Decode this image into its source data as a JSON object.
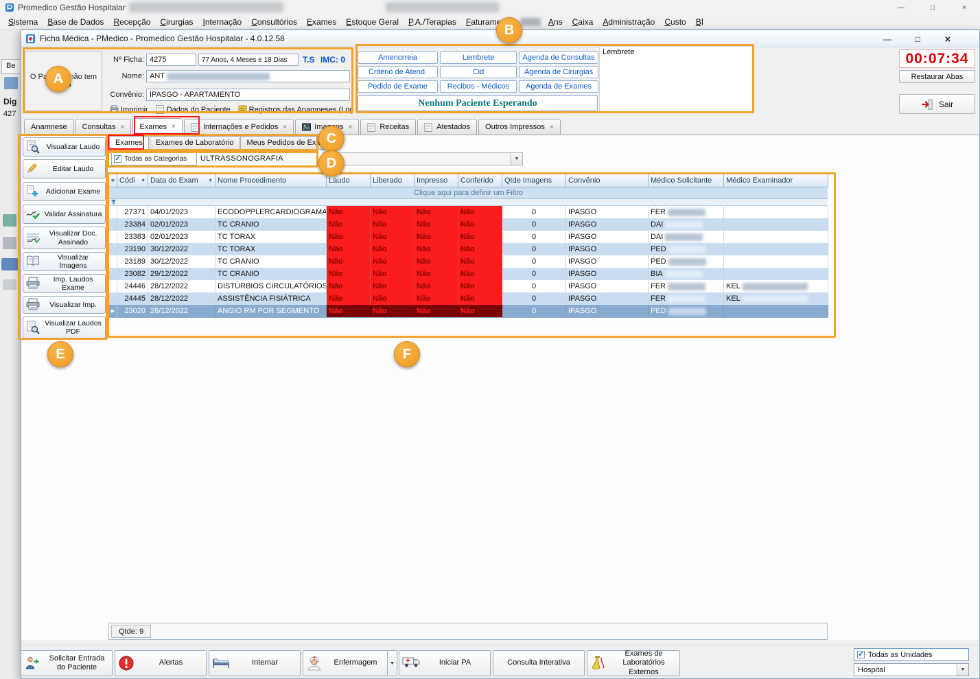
{
  "window": {
    "title": "Promedico Gestão Hospitalar",
    "inner_title": "Ficha Médica - PMedico - Promedico Gestão Hospitalar - 4.0.12.58"
  },
  "menu": {
    "items": [
      "Sistema",
      "Base de Dados",
      "Recepção",
      "Cirurgias",
      "Internação",
      "Consultórios",
      "Exames",
      "Estoque Geral",
      "P.A./Terapias",
      "Faturamento",
      "Ans",
      "Caixa",
      "Administração",
      "Custo",
      "BI"
    ]
  },
  "background_fragments": {
    "partial_tab": "Be",
    "label_dig": "Dig",
    "label_427": "427"
  },
  "patient": {
    "photo_placeholder": "O Paciente não tem Foto",
    "ficha_label": "Nº Ficha:",
    "ficha_value": "4275",
    "age_text": "77 Anos, 4 Meses e 18 Dias",
    "ts_label": "T.S",
    "imc_label": "IMC: 0",
    "nome_label": "Nome:",
    "nome_value_visible": "ANT",
    "convenio_label": "Convênio:",
    "convenio_value": "IPASGO - APARTAMENTO",
    "toolbar_items": [
      "Imprimir",
      "Dados do Paciente",
      "Registros das Anamneses (Log"
    ]
  },
  "quick_actions": {
    "buttons": [
      "Amenorreia",
      "Lembrete",
      "Agenda de Consultas",
      "Critério de Atend.",
      "Cid",
      "Agenda de Cirurgias",
      "Pedido de Exame",
      "Recibos - Médicos",
      "Agenda de Exames"
    ],
    "waiting_banner": "Nenhum Paciente Esperando"
  },
  "lembrete_panel": {
    "title": "Lembrete"
  },
  "session": {
    "timer": "00:07:34",
    "restore_tabs_label": "Restaurar Abas",
    "exit_label": "Sair"
  },
  "tabs": [
    {
      "label": "Anamnese",
      "close": false,
      "icon": false,
      "active": false
    },
    {
      "label": "Consultas",
      "close": true,
      "icon": false,
      "active": false
    },
    {
      "label": "Exames",
      "close": true,
      "icon": false,
      "active": true
    },
    {
      "label": "Internações e Pedidos",
      "close": true,
      "icon": true,
      "active": false
    },
    {
      "label": "Imagens",
      "close": true,
      "icon": true,
      "active": false
    },
    {
      "label": "Receitas",
      "close": false,
      "icon": true,
      "active": false
    },
    {
      "label": "Atestados",
      "close": false,
      "icon": true,
      "active": false
    },
    {
      "label": "Outros Impressos",
      "close": true,
      "icon": false,
      "active": false
    }
  ],
  "subtabs": [
    {
      "label": "Exames",
      "active": true
    },
    {
      "label": "Exames de Laboratório",
      "active": false
    },
    {
      "label": "Meus Pedidos de Exame",
      "active": false
    }
  ],
  "category_filter": {
    "checkbox_label": "Todas as Categorias",
    "checked": true,
    "category_text": "ULTRASSONOGRAFIA"
  },
  "sidebar": {
    "items": [
      {
        "label": "Visualizar Laudo",
        "icon": "view-report-icon"
      },
      {
        "label": "Editar Laudo",
        "icon": "edit-pencil-icon"
      },
      {
        "label": "Adicionar Exame",
        "icon": "add-exam-icon"
      },
      {
        "label": "Validar Assinatura",
        "icon": "validate-signature-icon"
      },
      {
        "label": "Visualizar Doc. Assinado",
        "icon": "signed-doc-icon"
      },
      {
        "label": "Visualizar Imagens",
        "icon": "view-images-icon"
      },
      {
        "label": "Imp. Laudos Exame",
        "icon": "print-report-icon"
      },
      {
        "label": "Visualizar Imp.",
        "icon": "print-preview-icon"
      },
      {
        "label": "Visualizar Laudos PDF",
        "icon": "view-pdf-icon"
      }
    ]
  },
  "grid": {
    "columns": [
      "Códi",
      "Data do Exam",
      "Nome Procedimento",
      "Laudo",
      "Liberado",
      "Impresso",
      "Conferido",
      "Qtde Imagens",
      "Convênio",
      "Médico Solicitante",
      "Médico Examinador"
    ],
    "filter_hint": "Clique aqui para definir um Filtro",
    "rows": [
      {
        "codigo": "27371",
        "data": "04/01/2023",
        "procedimento": "ECODOPPLERCARDIOGRAMA",
        "laudo": "Não",
        "liberado": "Não",
        "impresso": "Não",
        "conferido": "Não",
        "qtde_imagens": "0",
        "convenio": "IPASGO",
        "solicitante": "FER",
        "examinador": "",
        "selected": false
      },
      {
        "codigo": "23384",
        "data": "02/01/2023",
        "procedimento": "TC CRANIO",
        "laudo": "Não",
        "liberado": "Não",
        "impresso": "Não",
        "conferido": "Não",
        "qtde_imagens": "0",
        "convenio": "IPASGO",
        "solicitante": "DAI",
        "examinador": "",
        "selected": false
      },
      {
        "codigo": "23383",
        "data": "02/01/2023",
        "procedimento": "TC TORAX",
        "laudo": "Não",
        "liberado": "Não",
        "impresso": "Não",
        "conferido": "Não",
        "qtde_imagens": "0",
        "convenio": "IPASGO",
        "solicitante": "DAI",
        "examinador": "",
        "selected": false
      },
      {
        "codigo": "23190",
        "data": "30/12/2022",
        "procedimento": "TC TORAX",
        "laudo": "Não",
        "liberado": "Não",
        "impresso": "Não",
        "conferido": "Não",
        "qtde_imagens": "0",
        "convenio": "IPASGO",
        "solicitante": "PED",
        "examinador": "",
        "selected": false
      },
      {
        "codigo": "23189",
        "data": "30/12/2022",
        "procedimento": "TC CRANIO",
        "laudo": "Não",
        "liberado": "Não",
        "impresso": "Não",
        "conferido": "Não",
        "qtde_imagens": "0",
        "convenio": "IPASGO",
        "solicitante": "PED",
        "examinador": "",
        "selected": false
      },
      {
        "codigo": "23082",
        "data": "29/12/2022",
        "procedimento": "TC CRANIO",
        "laudo": "Não",
        "liberado": "Não",
        "impresso": "Não",
        "conferido": "Não",
        "qtde_imagens": "0",
        "convenio": "IPASGO",
        "solicitante": "BIA",
        "examinador": "",
        "selected": false
      },
      {
        "codigo": "24446",
        "data": "28/12/2022",
        "procedimento": "DISTÚRBIOS CIRCULATÓRIOS",
        "laudo": "Não",
        "liberado": "Não",
        "impresso": "Não",
        "conferido": "Não",
        "qtde_imagens": "0",
        "convenio": "IPASGO",
        "solicitante": "FER",
        "examinador": "KEL",
        "selected": false
      },
      {
        "codigo": "24445",
        "data": "28/12/2022",
        "procedimento": "ASSISTÊNCIA FISIÁTRICA",
        "laudo": "Não",
        "liberado": "Não",
        "impresso": "Não",
        "conferido": "Não",
        "qtde_imagens": "0",
        "convenio": "IPASGO",
        "solicitante": "FER",
        "examinador": "KEL",
        "selected": false
      },
      {
        "codigo": "23020",
        "data": "28/12/2022",
        "procedimento": "ANGIO RM POR SEGMENTO",
        "laudo": "Não",
        "liberado": "Não",
        "impresso": "Não",
        "conferido": "Não",
        "qtde_imagens": "0",
        "convenio": "IPASGO",
        "solicitante": "PED",
        "examinador": "",
        "selected": true
      }
    ],
    "count_label": "Qtde: 9"
  },
  "bottom_toolbar": {
    "buttons": [
      {
        "label": "Solicitar Entrada do Paciente",
        "icon": "patient-entry-icon",
        "split": false
      },
      {
        "label": "Alertas",
        "icon": "alert-icon",
        "split": false
      },
      {
        "label": "Internar",
        "icon": "hospital-bed-icon",
        "split": false
      },
      {
        "label": "Enfermagem",
        "icon": "nurse-icon",
        "split": true
      },
      {
        "label": "Iniciar PA",
        "icon": "ambulance-icon",
        "split": false
      },
      {
        "label": "Consulta Interativa",
        "icon": null,
        "split": false
      },
      {
        "label": "Exames de Laboratórios Externos",
        "icon": "lab-flask-icon",
        "split": false
      }
    ]
  },
  "units": {
    "checkbox_label": "Todas as Unidades",
    "checked": true,
    "selected_unit": "Hospital"
  },
  "annotations": {
    "letters": [
      "A",
      "B",
      "C",
      "D",
      "E",
      "F"
    ]
  },
  "icons": {
    "close": "×",
    "minimize": "—",
    "maximize": "□",
    "dropdown_arrow": "▼",
    "check": "✓",
    "row_pointer": "▶",
    "corner_asterisk": "✱"
  },
  "colors": {
    "annotation_orange": "#F2A22E",
    "highlight_red": "#FF1616",
    "nao_cell_red": "#FB1D1D",
    "nao_text_dark_red": "#8C0404",
    "selected_row_blue": "#8AABD0",
    "timer_red": "#D80000",
    "banner_teal": "#0A7878",
    "quick_button_blue": "#0A5AC8"
  }
}
